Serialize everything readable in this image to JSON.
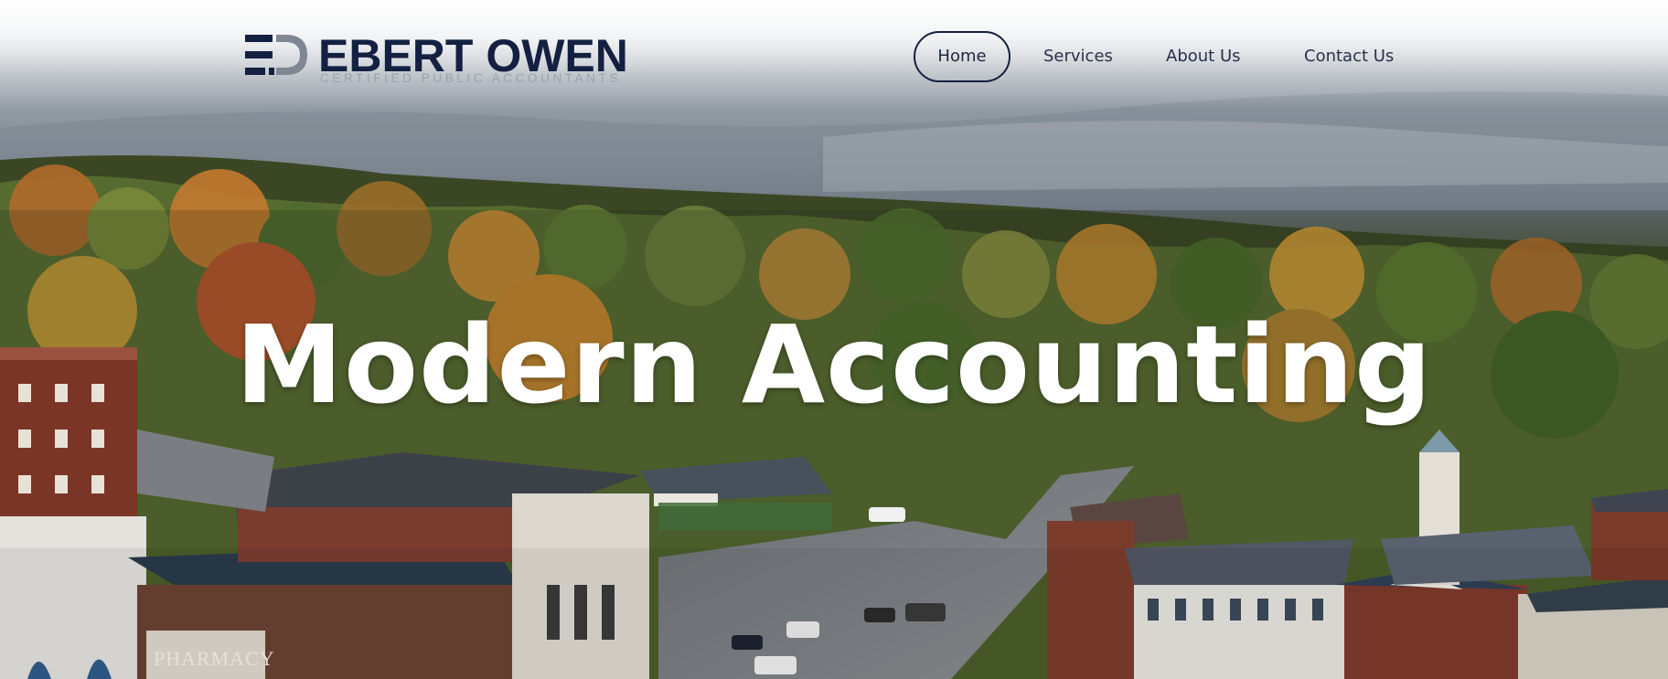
{
  "brand": {
    "name": "EBERT OWEN",
    "tagline": "CERTIFIED PUBLIC ACCOUNTANTS",
    "logo_icon": "ebert-owen-ed-monogram",
    "primary_color": "#142042"
  },
  "nav": {
    "items": [
      {
        "label": "Home",
        "active": true
      },
      {
        "label": "Services",
        "active": false
      },
      {
        "label": "About Us",
        "active": false
      },
      {
        "label": "Contact Us",
        "active": false
      }
    ]
  },
  "hero": {
    "headline": "Modern Accounting",
    "background": "aerial town photo in autumn",
    "sign_text": "PHARMACY"
  }
}
